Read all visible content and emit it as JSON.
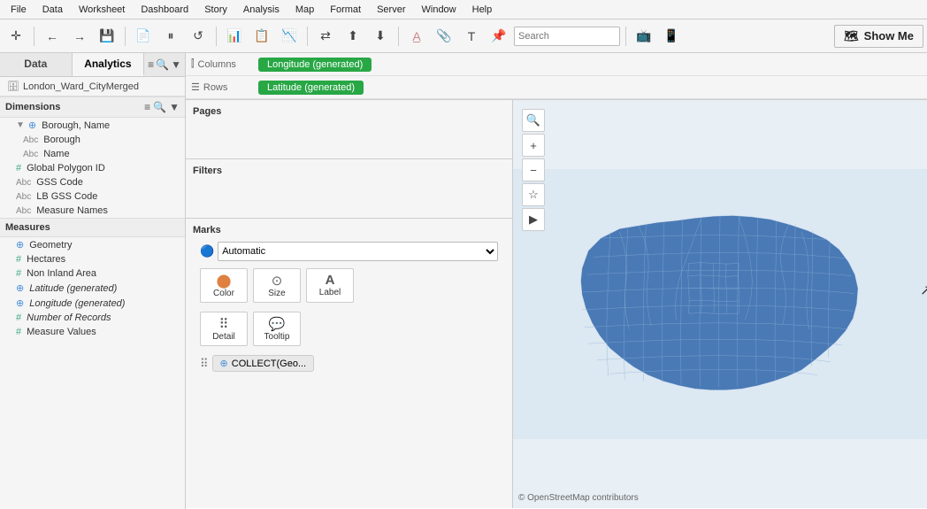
{
  "menu": {
    "items": [
      "File",
      "Data",
      "Worksheet",
      "Dashboard",
      "Story",
      "Analysis",
      "Map",
      "Format",
      "Server",
      "Window",
      "Help"
    ]
  },
  "toolbar": {
    "search_placeholder": "Search",
    "show_me_label": "Show Me"
  },
  "tabs": {
    "data_label": "Data",
    "analytics_label": "Analytics"
  },
  "data_source": {
    "name": "London_Ward_CityMerged"
  },
  "dimensions": {
    "section_label": "Dimensions",
    "groups": [
      {
        "name": "Borough, Name",
        "icon": "geo",
        "children": [
          {
            "name": "Borough",
            "icon": "abc"
          },
          {
            "name": "Name",
            "icon": "abc"
          }
        ]
      }
    ],
    "items": [
      {
        "name": "Global Polygon ID",
        "icon": "hash"
      },
      {
        "name": "GSS Code",
        "icon": "abc"
      },
      {
        "name": "LB GSS Code",
        "icon": "abc"
      },
      {
        "name": "Measure Names",
        "icon": "abc"
      }
    ]
  },
  "measures": {
    "section_label": "Measures",
    "items": [
      {
        "name": "Geometry",
        "icon": "geo"
      },
      {
        "name": "Hectares",
        "icon": "hash"
      },
      {
        "name": "Non Inland Area",
        "icon": "hash"
      },
      {
        "name": "Latitude (generated)",
        "icon": "geo",
        "italic": true
      },
      {
        "name": "Longitude (generated)",
        "icon": "geo",
        "italic": true
      },
      {
        "name": "Number of Records",
        "icon": "hash",
        "italic": true
      },
      {
        "name": "Measure Values",
        "icon": "hash"
      }
    ]
  },
  "shelves": {
    "columns_label": "Columns",
    "columns_pill": "Longitude (generated)",
    "rows_label": "Rows",
    "rows_pill": "Latitude (generated)"
  },
  "panels": {
    "pages_label": "Pages",
    "filters_label": "Filters",
    "marks_label": "Marks",
    "marks_type": "Automatic",
    "marks_buttons": [
      {
        "label": "Color",
        "icon": "⬤⬤"
      },
      {
        "label": "Size",
        "icon": "⬤"
      },
      {
        "label": "Label",
        "icon": "A"
      }
    ],
    "marks_buttons2": [
      {
        "label": "Detail",
        "icon": "⠿"
      },
      {
        "label": "Tooltip",
        "icon": "💬"
      }
    ],
    "collect_pill": "COLLECT(Geo..."
  },
  "map": {
    "attribution": "© OpenStreetMap contributors"
  }
}
